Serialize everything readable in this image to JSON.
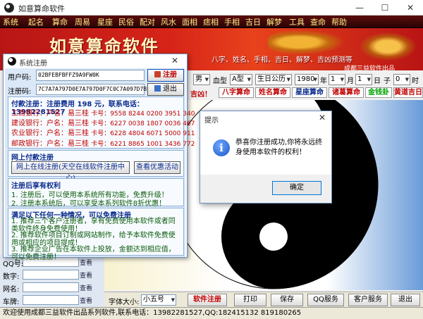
{
  "window": {
    "title": "如意算命软件",
    "minimize": "—",
    "maximize": "☐",
    "close": "✕"
  },
  "menu": [
    "系统",
    "起名",
    "算命",
    "周易",
    "星座",
    "民俗",
    "配对",
    "风水",
    "面相",
    "手相",
    "痣相",
    "手相",
    "吉日",
    "解梦",
    "工具",
    "查命",
    "帮助"
  ],
  "banner": {
    "title": "如意算命软件",
    "subtitle": "八字、姓名、手相、吉日、解梦、吉凶预测等",
    "right": "成都三益软件出品"
  },
  "birth_row": {
    "gender": "男",
    "blood_label": "血型",
    "blood": "A型",
    "birthday_label": "生日公历",
    "year": "1980",
    "year_unit": "年",
    "month": "1",
    "month_unit": "月",
    "day": "1",
    "day_unit": "日",
    "hour_label": "子",
    "hour": "0",
    "hour_unit": "时"
  },
  "feature_row": {
    "prefix": "吉凶！",
    "items": [
      "八字算命",
      "姓名算命",
      "星座算命",
      "诸葛算命",
      "金钱卦",
      "黄道吉日"
    ],
    "colors": [
      "#c00000",
      "#c00000",
      "#0a2a8c",
      "#c00000",
      "#00a000",
      "#c00000"
    ]
  },
  "register": {
    "title": "系统注册",
    "close": "✕",
    "user_code_label": "用户码:",
    "user_code": "02BFEBFBFFZ9A9FW0K",
    "reg_code_label": "注册码:",
    "reg_code": "7C7A7A797D0E7A797D0F7C0C7A097D7B",
    "register_button": "注册",
    "exit_button": "退出",
    "pay_title": "付款注册：注册费用 198 元，联系电话：13982281527",
    "banks": [
      {
        "name": "工商银行：",
        "holder": "户名：易三桂",
        "card": "卡号：9558 8244 0200 3951 340"
      },
      {
        "name": "建设银行：",
        "holder": "户名：易三桂",
        "card": "卡号：6227 0038 1807 0036 467"
      },
      {
        "name": "农业银行：",
        "holder": "户名：易三桂",
        "card": "卡号：6228 4804 6071 5000 911"
      },
      {
        "name": "邮政银行：",
        "holder": "户名：易三桂",
        "card": "卡号：6221 8865 1001 3436 772"
      }
    ],
    "online_title": "网上付款注册",
    "online_button": "网上在线注册(天空在线软件注册中心)",
    "discount_button": "查看优惠活动",
    "rights_title": "注册后享有权利",
    "rights": [
      "1. 注册后，可以使用本系统所有功能，免费升级！",
      "2. 注册本系统后，可以享受本系列软件8折优惠！"
    ],
    "free_title": "满足以下任何一种情况，可以免费注册",
    "free": [
      "1. 推荐三个客户注册者，享有免费使用本软件或者同类软件终身免费使用！",
      "2. 推荐软件项目订制或网站制作，给予本软件免费使用或相应的项目提成！",
      "3. 推荐企业广告在本软件上投放，金额达到相应值，可以免费注册！"
    ]
  },
  "query": {
    "rows": [
      {
        "label": "QQ号:",
        "button": "查看"
      },
      {
        "label": "数字:",
        "button": "查看"
      },
      {
        "label": "网名:",
        "button": "查看"
      },
      {
        "label": "车牌:",
        "button": "查看"
      }
    ]
  },
  "toolbar": {
    "font_label": "字体大小:",
    "font_value": "小五号",
    "register": "软件注册",
    "print": "打印",
    "save": "保存",
    "qq": "QQ服务",
    "service": "客户服务",
    "exit": "退出"
  },
  "status": "欢迎使用成都三益软件出品系列软件,联系电话：13982281527,QQ:182415132 819180265",
  "alert": {
    "title": "提示",
    "close": "✕",
    "message": "恭喜你注册成功,你将永远终身使用本软件的权利！",
    "ok": "确定"
  }
}
